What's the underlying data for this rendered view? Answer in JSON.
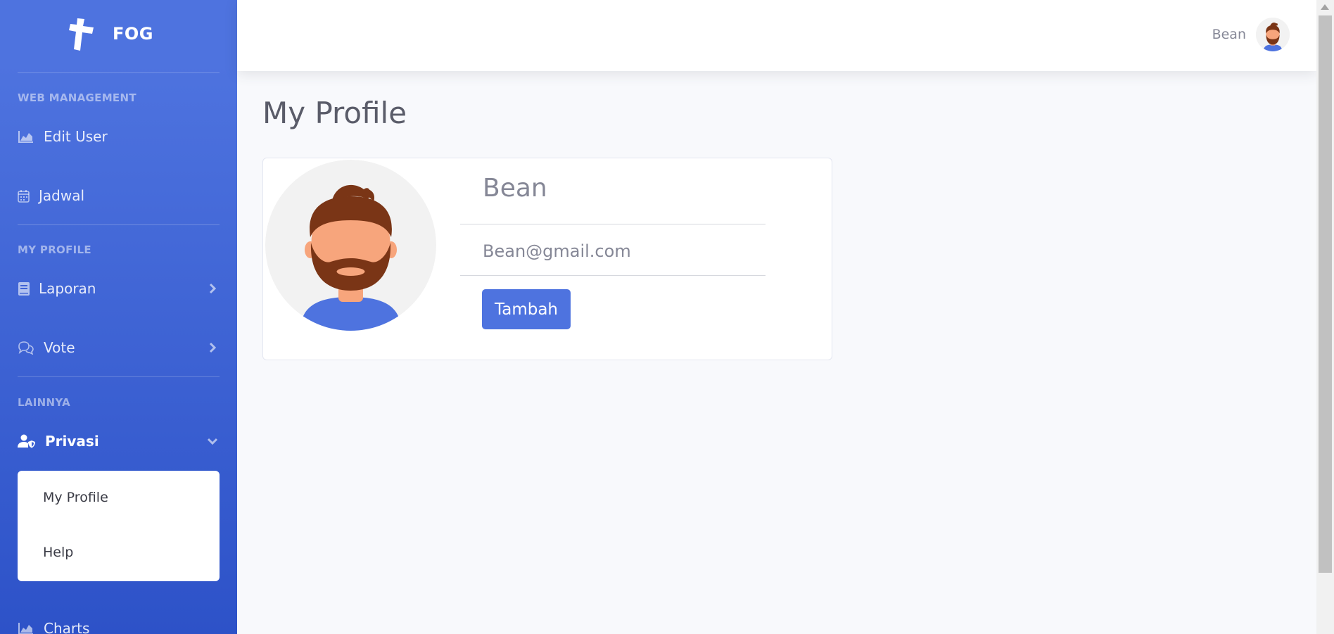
{
  "brand": {
    "name": "FOG",
    "icon": "cross-icon"
  },
  "sidebar": {
    "headings": {
      "web_management": "WEB MANAGEMENT",
      "my_profile": "MY PROFILE",
      "lainnya": "LAINNYA"
    },
    "items": {
      "edit_user": {
        "label": "Edit User",
        "icon": "area-chart-icon"
      },
      "jadwal": {
        "label": "Jadwal",
        "icon": "calendar-icon"
      },
      "laporan": {
        "label": "Laporan",
        "icon": "book-icon"
      },
      "vote": {
        "label": "Vote",
        "icon": "comments-icon"
      },
      "privasi": {
        "label": "Privasi",
        "icon": "user-shield-icon"
      },
      "charts": {
        "label": "Charts",
        "icon": "area-chart-icon"
      }
    },
    "submenu": {
      "my_profile": "My Profile",
      "help": "Help"
    }
  },
  "topbar": {
    "user_name": "Bean"
  },
  "main": {
    "title": "My Profile",
    "profile": {
      "name": "Bean",
      "email": "Bean@gmail.com",
      "button": "Tambah"
    }
  },
  "colors": {
    "primary": "#4e73df",
    "sidebar_dark": "#2d52c8",
    "background": "#f8f9fc"
  }
}
